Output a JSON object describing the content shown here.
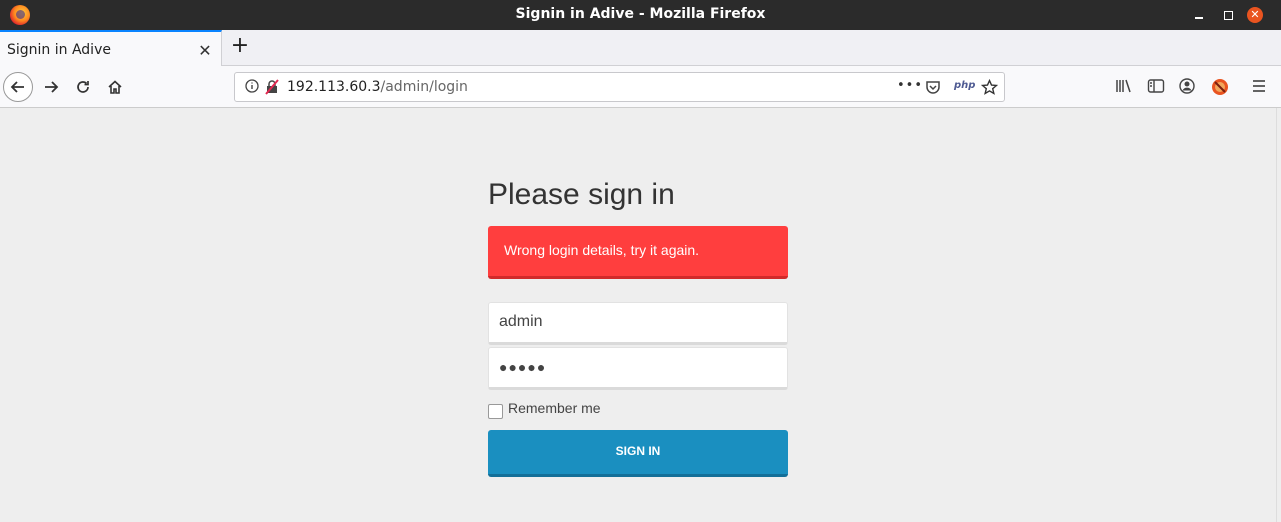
{
  "window": {
    "title": "Signin in Adive - Mozilla Firefox",
    "minimize_label": "",
    "maximize_label": "",
    "close_label": "✕"
  },
  "tab": {
    "label": "Signin in Adive",
    "close": "✕"
  },
  "newtab": {
    "label": "+"
  },
  "url": {
    "host": "192.113.60.3",
    "path": "/admin/login"
  },
  "toolbar": {
    "more": "•••",
    "php": "php"
  },
  "page": {
    "heading": "Please sign in",
    "alert": "Wrong login details, try it again.",
    "username_value": "admin",
    "password_mask": "●●●●●",
    "remember_label": "Remember me",
    "signin_label": "SIGN IN"
  },
  "colors": {
    "alert": "#ff3e3e",
    "button": "#1a8fc0",
    "tab_accent": "#0a84ff"
  }
}
